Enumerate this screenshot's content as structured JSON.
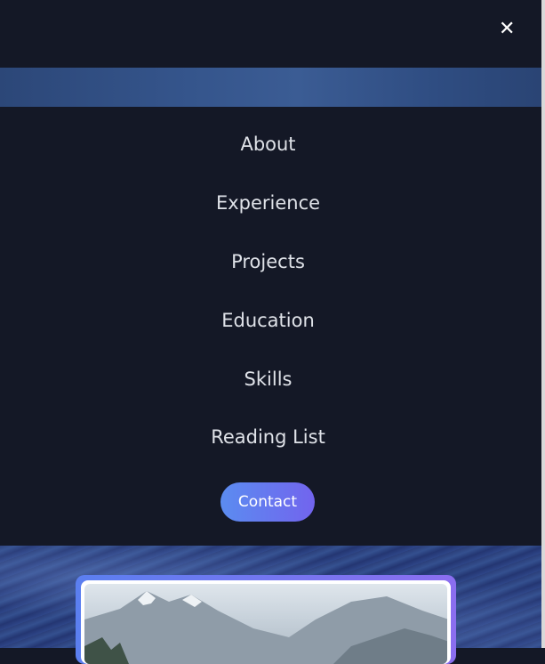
{
  "header": {
    "close_icon": "close-icon",
    "close_glyph": "✕"
  },
  "menu": {
    "items": [
      {
        "label": "About"
      },
      {
        "label": "Experience"
      },
      {
        "label": "Projects"
      },
      {
        "label": "Education"
      },
      {
        "label": "Skills"
      },
      {
        "label": "Reading List"
      }
    ],
    "contact_label": "Contact"
  },
  "colors": {
    "background": "#141826",
    "menu_text": "#dfe2e8",
    "contact_gradient_start": "#5b8cf0",
    "contact_gradient_end": "#7264ee"
  }
}
